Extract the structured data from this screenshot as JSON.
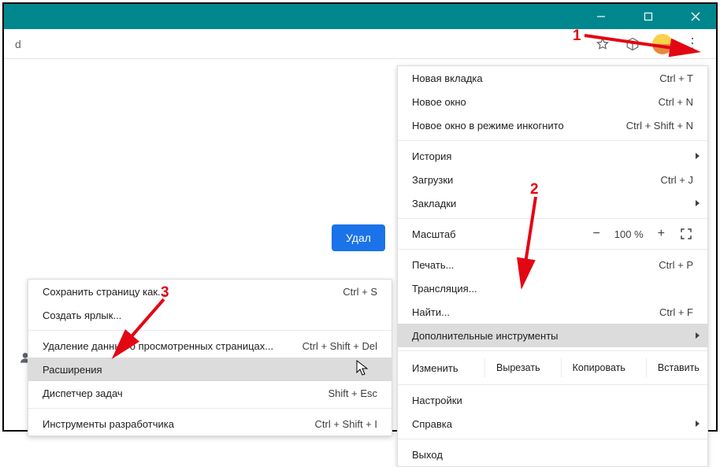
{
  "titlebar": {},
  "omnibox_text": "d",
  "blue_button": "Удал",
  "menu1": {
    "new_tab": "Новая вкладка",
    "new_tab_sc": "Ctrl + T",
    "new_window": "Новое окно",
    "new_window_sc": "Ctrl + N",
    "incognito": "Новое окно в режиме инкогнито",
    "incognito_sc": "Ctrl + Shift + N",
    "history": "История",
    "downloads": "Загрузки",
    "downloads_sc": "Ctrl + J",
    "bookmarks": "Закладки",
    "zoom_label": "Масштаб",
    "zoom_value": "100 %",
    "print": "Печать...",
    "print_sc": "Ctrl + P",
    "cast": "Трансляция...",
    "find": "Найти...",
    "find_sc": "Ctrl + F",
    "more_tools": "Дополнительные инструменты",
    "edit": "Изменить",
    "cut": "Вырезать",
    "copy": "Копировать",
    "paste": "Вставить",
    "settings": "Настройки",
    "help": "Справка",
    "exit": "Выход"
  },
  "menu2": {
    "save_as": "Сохранить страницу как...",
    "save_as_sc": "Ctrl + S",
    "shortcut": "Создать ярлык...",
    "clear_data": "Удаление данных о просмотренных страницах...",
    "clear_data_sc": "Ctrl + Shift + Del",
    "extensions": "Расширения",
    "task_mgr": "Диспетчер задач",
    "task_mgr_sc": "Shift + Esc",
    "dev_tools": "Инструменты разработчика",
    "dev_tools_sc": "Ctrl + Shift + I"
  },
  "annotations": {
    "n1": "1",
    "n2": "2",
    "n3": "3"
  }
}
